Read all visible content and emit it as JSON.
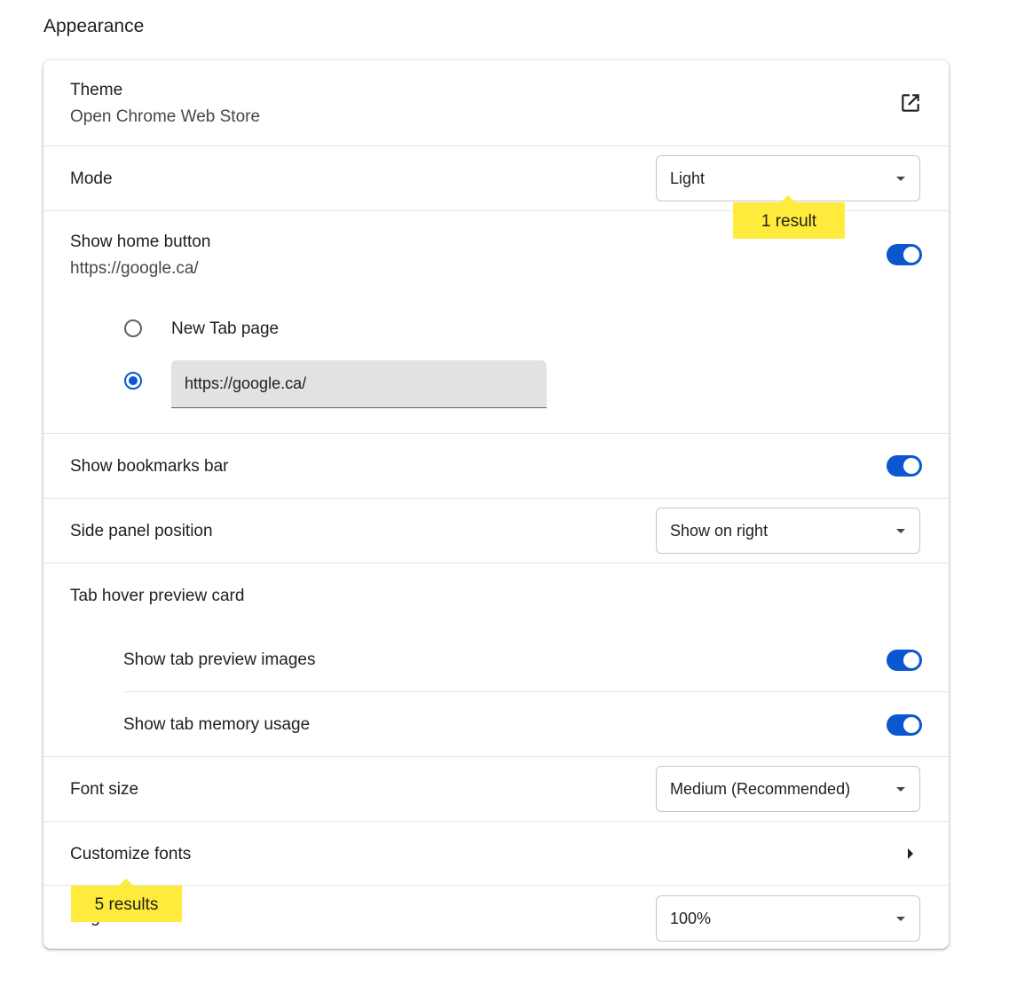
{
  "section": {
    "title": "Appearance"
  },
  "theme": {
    "label": "Theme",
    "sublabel": "Open Chrome Web Store",
    "icon": "open-in-new-icon"
  },
  "mode": {
    "label": "Mode",
    "value": "Light",
    "search_bubble": "1 result"
  },
  "home_button": {
    "label": "Show home button",
    "sublabel": "https://google.ca/",
    "enabled": true,
    "options": [
      {
        "label": "New Tab page",
        "selected": false
      },
      {
        "value": "https://google.ca/",
        "selected": true
      }
    ]
  },
  "bookmarks_bar": {
    "label": "Show bookmarks bar",
    "enabled": true
  },
  "side_panel": {
    "label": "Side panel position",
    "value": "Show on right"
  },
  "tab_hover": {
    "label": "Tab hover preview card",
    "preview_images": {
      "label": "Show tab preview images",
      "enabled": true
    },
    "memory_usage": {
      "label": "Show tab memory usage",
      "enabled": true
    }
  },
  "font_size": {
    "label": "Font size",
    "value": "Medium (Recommended)"
  },
  "customize_fonts": {
    "label": "Customize fonts",
    "search_bubble": "5 results"
  },
  "page_zoom": {
    "label": "Page zoom",
    "value": "100%"
  },
  "colors": {
    "accent": "#0b57d0",
    "highlight": "#ffeb3b"
  }
}
